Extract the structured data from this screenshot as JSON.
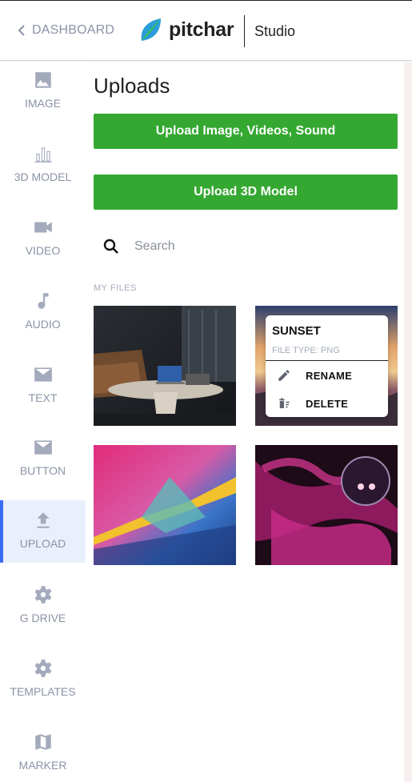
{
  "header": {
    "back_label": "DASHBOARD",
    "logo_text": "pitchar",
    "product": "Studio"
  },
  "sidebar": {
    "items": [
      {
        "label": "IMAGE",
        "icon": "image-icon"
      },
      {
        "label": "3D MODEL",
        "icon": "bar-chart-icon"
      },
      {
        "label": "VIDEO",
        "icon": "video-camera-icon"
      },
      {
        "label": "AUDIO",
        "icon": "music-note-icon"
      },
      {
        "label": "TEXT",
        "icon": "envelope-icon"
      },
      {
        "label": "BUTTON",
        "icon": "envelope-icon"
      },
      {
        "label": "UPLOAD",
        "icon": "upload-icon",
        "active": true
      },
      {
        "label": "G DRIVE",
        "icon": "gear-icon"
      },
      {
        "label": "TEMPLATES",
        "icon": "gear-icon"
      },
      {
        "label": "MARKER",
        "icon": "map-icon"
      }
    ]
  },
  "main": {
    "title": "Uploads",
    "upload_media_label": "Upload Image, Videos, Sound",
    "upload_3d_label": "Upload 3D Model",
    "search_placeholder": "Search",
    "section_label": "MY FILES"
  },
  "context_menu": {
    "title": "SUNSET",
    "subtitle": "FILE TYPE: PNG",
    "rename_label": "RENAME",
    "delete_label": "DELETE"
  },
  "colors": {
    "accent_green": "#35a832",
    "active_blue": "#3b6df2",
    "active_bg": "#eaf0fb",
    "muted_text": "#8a93a6"
  }
}
